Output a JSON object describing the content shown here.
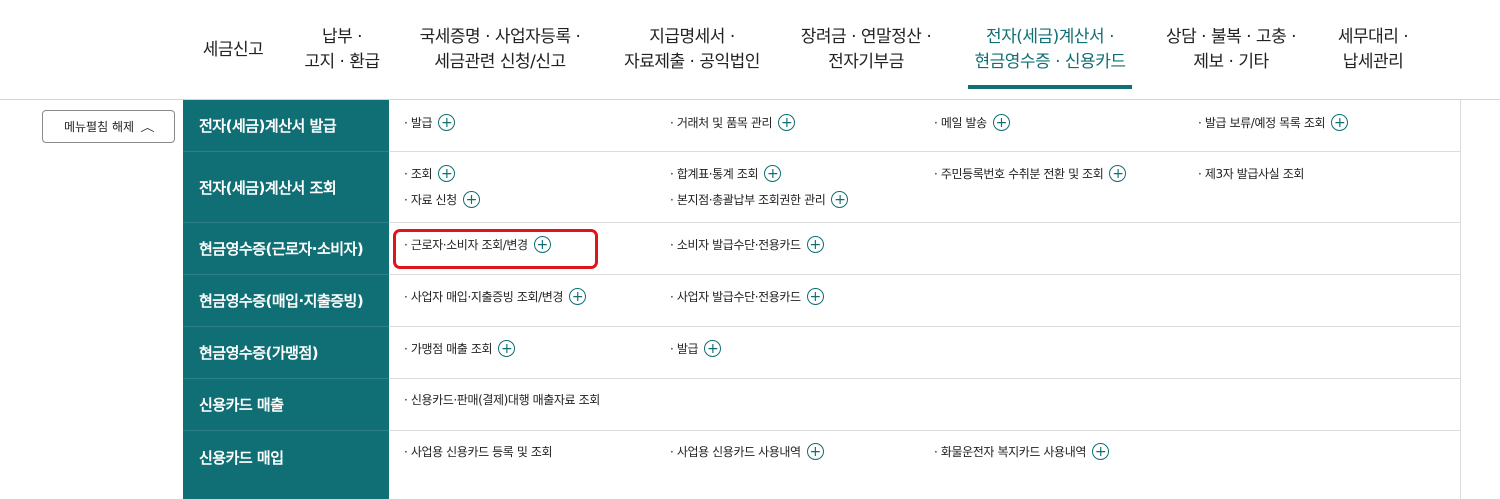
{
  "nav": {
    "items": [
      {
        "label": "세금신고"
      },
      {
        "label": "납부 ·\n고지 · 환급"
      },
      {
        "label": "국세증명 · 사업자등록 ·\n세금관련 신청/신고"
      },
      {
        "label": "지급명세서 ·\n자료제출 · 공익법인"
      },
      {
        "label": "장려금 · 연말정산 ·\n전자기부금"
      },
      {
        "label": "전자(세금)계산서 ·\n현금영수증 · 신용카드",
        "active": true
      },
      {
        "label": "상담 · 불복 · 고충 ·\n제보 · 기타"
      },
      {
        "label": "세무대리 ·\n납세관리"
      }
    ],
    "active_color": "#0f6f74"
  },
  "collapse_button": {
    "label": "메뉴펼침 해제",
    "icon": "chevron-up-icon"
  },
  "categories": [
    {
      "title": "전자(세금)계산서 발급",
      "links": [
        "· 발급",
        "· 거래처 및 품목 관리",
        "· 메일 발송",
        "· 발급 보류/예정 목록 조회"
      ]
    },
    {
      "title": "전자(세금)계산서 조회",
      "links": [
        "· 조회",
        "· 합계표·통계 조회",
        "· 주민등록번호 수취분 전환 및 조회",
        "· 제3자 발급사실 조회",
        "· 자료 신청",
        "· 본지점·총괄납부 조회권한 관리"
      ]
    },
    {
      "title": "현금영수증(근로자·소비자)",
      "links": [
        "· 근로자·소비자 조회/변경",
        "· 소비자 발급수단·전용카드"
      ]
    },
    {
      "title": "현금영수증(매입·지출증빙)",
      "links": [
        "· 사업자 매입·지출증빙 조회/변경",
        "· 사업자 발급수단·전용카드"
      ]
    },
    {
      "title": "현금영수증(가맹점)",
      "links": [
        "· 가맹점 매출 조회",
        "· 발급"
      ]
    },
    {
      "title": "신용카드 매출",
      "links": [
        "· 신용카드·판매(결제)대행 매출자료 조회"
      ]
    },
    {
      "title": "신용카드 매입",
      "links": [
        "· 사업용 신용카드 등록 및 조회",
        "· 사업용 신용카드 사용내역",
        "· 화물운전자 복지카드 사용내역"
      ]
    }
  ],
  "colors": {
    "brand": "#0f6f74",
    "highlight": "#e0121b"
  }
}
